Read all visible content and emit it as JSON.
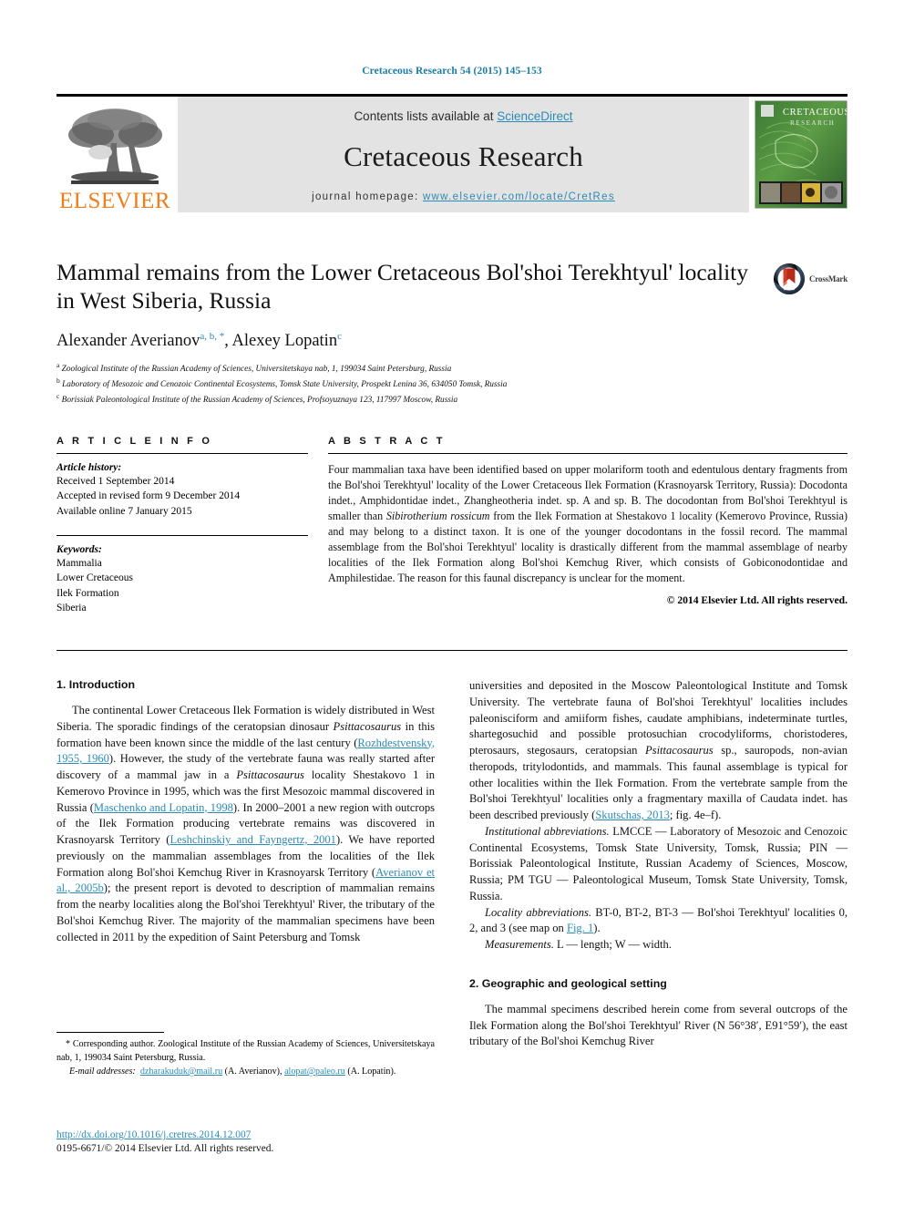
{
  "running_head": "Cretaceous Research 54 (2015) 145–153",
  "header": {
    "contents_prefix": "Contents lists available at ",
    "sciencedirect": "ScienceDirect",
    "journal_title": "Cretaceous Research",
    "homepage_prefix": "journal homepage: ",
    "homepage_url": "www.elsevier.com/locate/CretRes",
    "publisher": "ELSEVIER",
    "cover_title_line1": "CRETACEOUS",
    "cover_title_line2": "RESEARCH",
    "link_color": "#2a8bb5",
    "elsevier_orange": "#f07d1a",
    "header_band_color": "#e3e3e3"
  },
  "article": {
    "title": "Mammal remains from the Lower Cretaceous Bol'shoi Terekhtyul' locality in West Siberia, Russia",
    "authors_plain": "Alexander Averianov a, b, *, Alexey Lopatin c",
    "author1": "Alexander Averianov",
    "author1_sup": "a, b, *",
    "author2": "Alexey Lopatin",
    "author2_sup": "c",
    "affiliations": [
      {
        "mark": "a",
        "text": "Zoological Institute of the Russian Academy of Sciences, Universitetskaya nab, 1, 199034 Saint Petersburg, Russia"
      },
      {
        "mark": "b",
        "text": "Laboratory of Mesozoic and Cenozoic Continental Ecosystems, Tomsk State University, Prospekt Lenina 36, 634050 Tomsk, Russia"
      },
      {
        "mark": "c",
        "text": "Borissiak Paleontological Institute of the Russian Academy of Sciences, Profsoyuznaya 123, 117997 Moscow, Russia"
      }
    ],
    "crossmark_label": "CrossMark"
  },
  "article_info": {
    "heading": "A R T I C L E  I N F O",
    "history_heading": "Article history:",
    "history": [
      "Received 1 September 2014",
      "Accepted in revised form 9 December 2014",
      "Available online 7 January 2015"
    ],
    "keywords_heading": "Keywords:",
    "keywords": [
      "Mammalia",
      "Lower Cretaceous",
      "Ilek Formation",
      "Siberia"
    ]
  },
  "abstract": {
    "heading": "A B S T R A C T",
    "part1": "Four mammalian taxa have been identified based on upper molariform tooth and edentulous dentary fragments from the Bol'shoi Terekhtyul' locality of the Lower Cretaceous Ilek Formation (Krasnoyarsk Territory, Russia): Docodonta indet., Amphidontidae indet., Zhangheotheria indet. sp. A and sp. B. The docodontan from Bol'shoi Terekhtyul is smaller than ",
    "taxon_italic": "Sibirotherium rossicum",
    "part2": " from the Ilek Formation at Shestakovo 1 locality (Kemerovo Province, Russia) and may belong to a distinct taxon. It is one of the younger docodontans in the fossil record. The mammal assemblage from the Bol'shoi Terekhtyul' locality is drastically different from the mammal assemblage of nearby localities of the Ilek Formation along Bol'shoi Kemchug River, which consists of Gobiconodontidae and Amphilestidae. The reason for this faunal discrepancy is unclear for the moment.",
    "copyright": "© 2014 Elsevier Ltd. All rights reserved."
  },
  "body": {
    "section1_title": "1.  Introduction",
    "section2_title": "2.  Geographic and geological setting",
    "left_p1_a": "The continental Lower Cretaceous Ilek Formation is widely distributed in West Siberia. The sporadic findings of the ceratopsian dinosaur ",
    "left_p1_italic1": "Psittacosaurus",
    "left_p1_b": " in this formation have been known since the middle of the last century (",
    "left_ref1": "Rozhdestvensky, 1955, 1960",
    "left_p1_c": "). However, the study of the vertebrate fauna was really started after discovery of a mammal jaw in a ",
    "left_p1_italic2": "Psittacosaurus",
    "left_p1_d": " locality Shestakovo 1 in Kemerovo Province in 1995, which was the first Mesozoic mammal discovered in Russia (",
    "left_ref2": "Maschenko and Lopatin, 1998",
    "left_p1_e": "). In 2000–2001 a new region with outcrops of the Ilek Formation producing vertebrate remains was discovered in Krasnoyarsk Territory (",
    "left_ref3": "Leshchinskiy and Fayngertz, 2001",
    "left_p1_f": "). We have reported previously on the mammalian assemblages from the localities of the Ilek Formation along Bol'shoi Kemchug River in Krasnoyarsk Territory (",
    "left_ref4": "Averianov et al., 2005b",
    "left_p1_g": "); the present report is devoted to description of mammalian remains from the nearby localities along the Bol'shoi Terekhtyul' River, the tributary of the Bol'shoi Kemchug River. The majority of the mammalian specimens have been collected in 2011 by the expedition of Saint Petersburg and Tomsk",
    "right_p1_a": "universities and deposited in the Moscow Paleontological Institute and Tomsk University. The vertebrate fauna of Bol'shoi Terekhtyul' localities includes paleonisciform and amiiform fishes, caudate amphibians, indeterminate turtles, shartegosuchid and possible protosuchian crocodyliforms, choristoderes, pterosaurs, stegosaurs, ceratopsian ",
    "right_p1_italic": "Psittacosaurus",
    "right_p1_b": " sp., sauropods, non-avian theropods, tritylodontids, and mammals. This faunal assemblage is typical for other localities within the Ilek Formation. From the vertebrate sample from the Bol'shoi Terekhtyul' localities only a fragmentary maxilla of Caudata indet. has been described previously (",
    "right_ref1": "Skutschas, 2013",
    "right_p1_c": "; fig. 4e–f).",
    "right_p2_head": "Institutional abbreviations.",
    "right_p2_text": " LMCCE — Laboratory of Mesozoic and Cenozoic Continental Ecosystems, Tomsk State University, Tomsk, Russia; PIN — Borissiak Paleontological Institute, Russian Academy of Sciences, Moscow, Russia; PM TGU — Paleontological Museum, Tomsk State University, Tomsk, Russia.",
    "right_p3_head": "Locality abbreviations.",
    "right_p3_a": " BT-0, BT-2, BT-3 — Bol'shoi Terekhtyul' localities 0, 2, and 3 (see map on ",
    "right_ref2": "Fig. 1",
    "right_p3_b": ").",
    "right_p4_head": "Measurements.",
    "right_p4_text": " L — length; W — width.",
    "right_p5": "The mammal specimens described herein come from several outcrops of the Ilek Formation along the Bol'shoi Terekhtyul' River (N 56°38′, E91°59′), the east tributary of the Bol'shoi Kemchug River"
  },
  "footnote": {
    "corr_star": "*",
    "corr_text": " Corresponding author. Zoological Institute of the Russian Academy of Sciences, Universitetskaya nab, 1, 199034 Saint Petersburg, Russia.",
    "email_label": "E-mail addresses:",
    "email1": "dzharakuduk@mail.ru",
    "email1_owner": " (A. Averianov), ",
    "email2": "alopat@paleo.ru",
    "email2_owner": " (A. Lopatin).",
    "doi": "http://dx.doi.org/10.1016/j.cretres.2014.12.007",
    "issn": "0195-6671/© 2014 Elsevier Ltd. All rights reserved."
  }
}
